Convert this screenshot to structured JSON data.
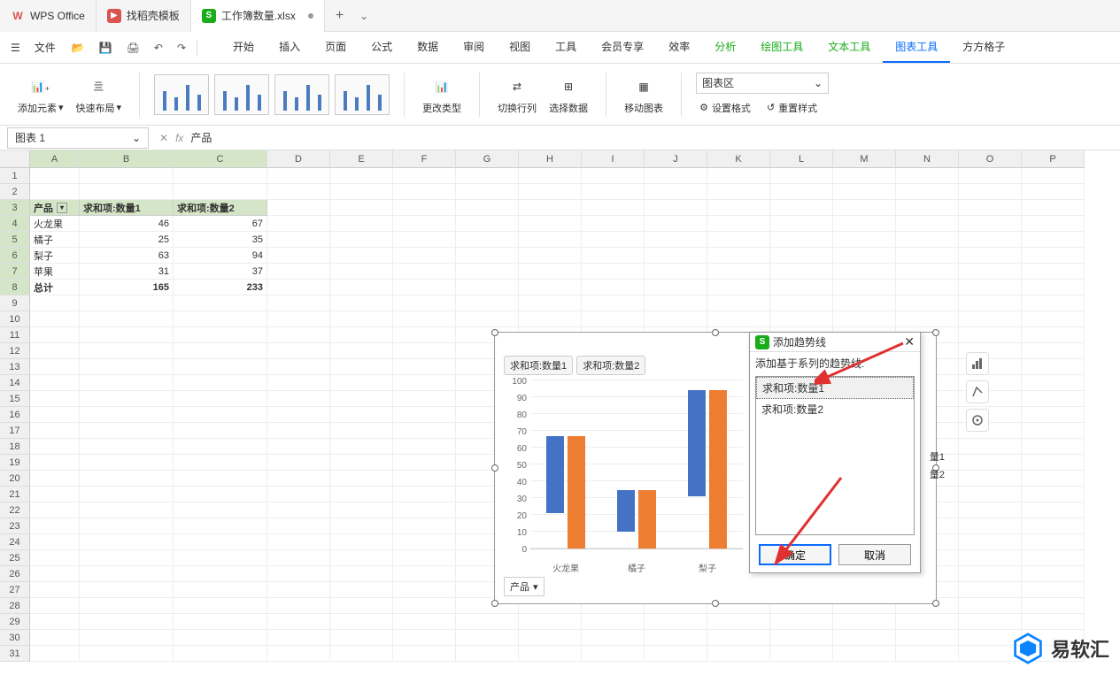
{
  "titlebar": {
    "app": "WPS Office",
    "template_tab": "找稻壳模板",
    "file_tab": "工作簿数量.xlsx"
  },
  "menu": {
    "file": "文件",
    "tabs": [
      "开始",
      "插入",
      "页面",
      "公式",
      "数据",
      "审阅",
      "视图",
      "工具",
      "会员专享",
      "效率",
      "分析",
      "绘图工具",
      "文本工具",
      "图表工具",
      "方方格子"
    ]
  },
  "ribbon": {
    "add_element": "添加元素",
    "quick_layout": "快速布局",
    "change_type": "更改类型",
    "switch_rc": "切换行列",
    "select_data": "选择数据",
    "move_chart": "移动图表",
    "chart_area_select": "图表区",
    "set_format": "设置格式",
    "reset_style": "重置样式"
  },
  "formula_bar": {
    "name_box": "图表 1",
    "formula": "产品"
  },
  "columns": [
    "A",
    "B",
    "C",
    "D",
    "E",
    "F",
    "G",
    "H",
    "I",
    "J",
    "K",
    "L",
    "M",
    "N",
    "O",
    "P"
  ],
  "table": {
    "headers": [
      "产品",
      "求和项:数量1",
      "求和项:数量2"
    ],
    "rows": [
      {
        "product": "火龙果",
        "q1": 46,
        "q2": 67
      },
      {
        "product": "橘子",
        "q1": 25,
        "q2": 35
      },
      {
        "product": "梨子",
        "q1": 63,
        "q2": 94
      },
      {
        "product": "苹果",
        "q1": 31,
        "q2": 37
      }
    ],
    "total_label": "总计",
    "total_q1": 165,
    "total_q2": 233
  },
  "chart_data": {
    "type": "bar",
    "categories": [
      "火龙果",
      "橘子",
      "梨子"
    ],
    "series": [
      {
        "name": "求和项:数量1",
        "values": [
          46,
          25,
          63
        ]
      },
      {
        "name": "求和项:数量2",
        "values": [
          67,
          35,
          94
        ]
      }
    ],
    "ylim": [
      0,
      100
    ],
    "yticks": [
      0,
      10,
      20,
      30,
      40,
      50,
      60,
      70,
      80,
      90,
      100
    ],
    "filter_label": "产品",
    "legend_labels": [
      "量1",
      "量2"
    ]
  },
  "dialog": {
    "title": "添加趋势线",
    "label": "添加基于系列的趋势线:",
    "items": [
      "求和项:数量1",
      "求和项:数量2"
    ],
    "ok": "确定",
    "cancel": "取消"
  },
  "watermark": "易软汇"
}
